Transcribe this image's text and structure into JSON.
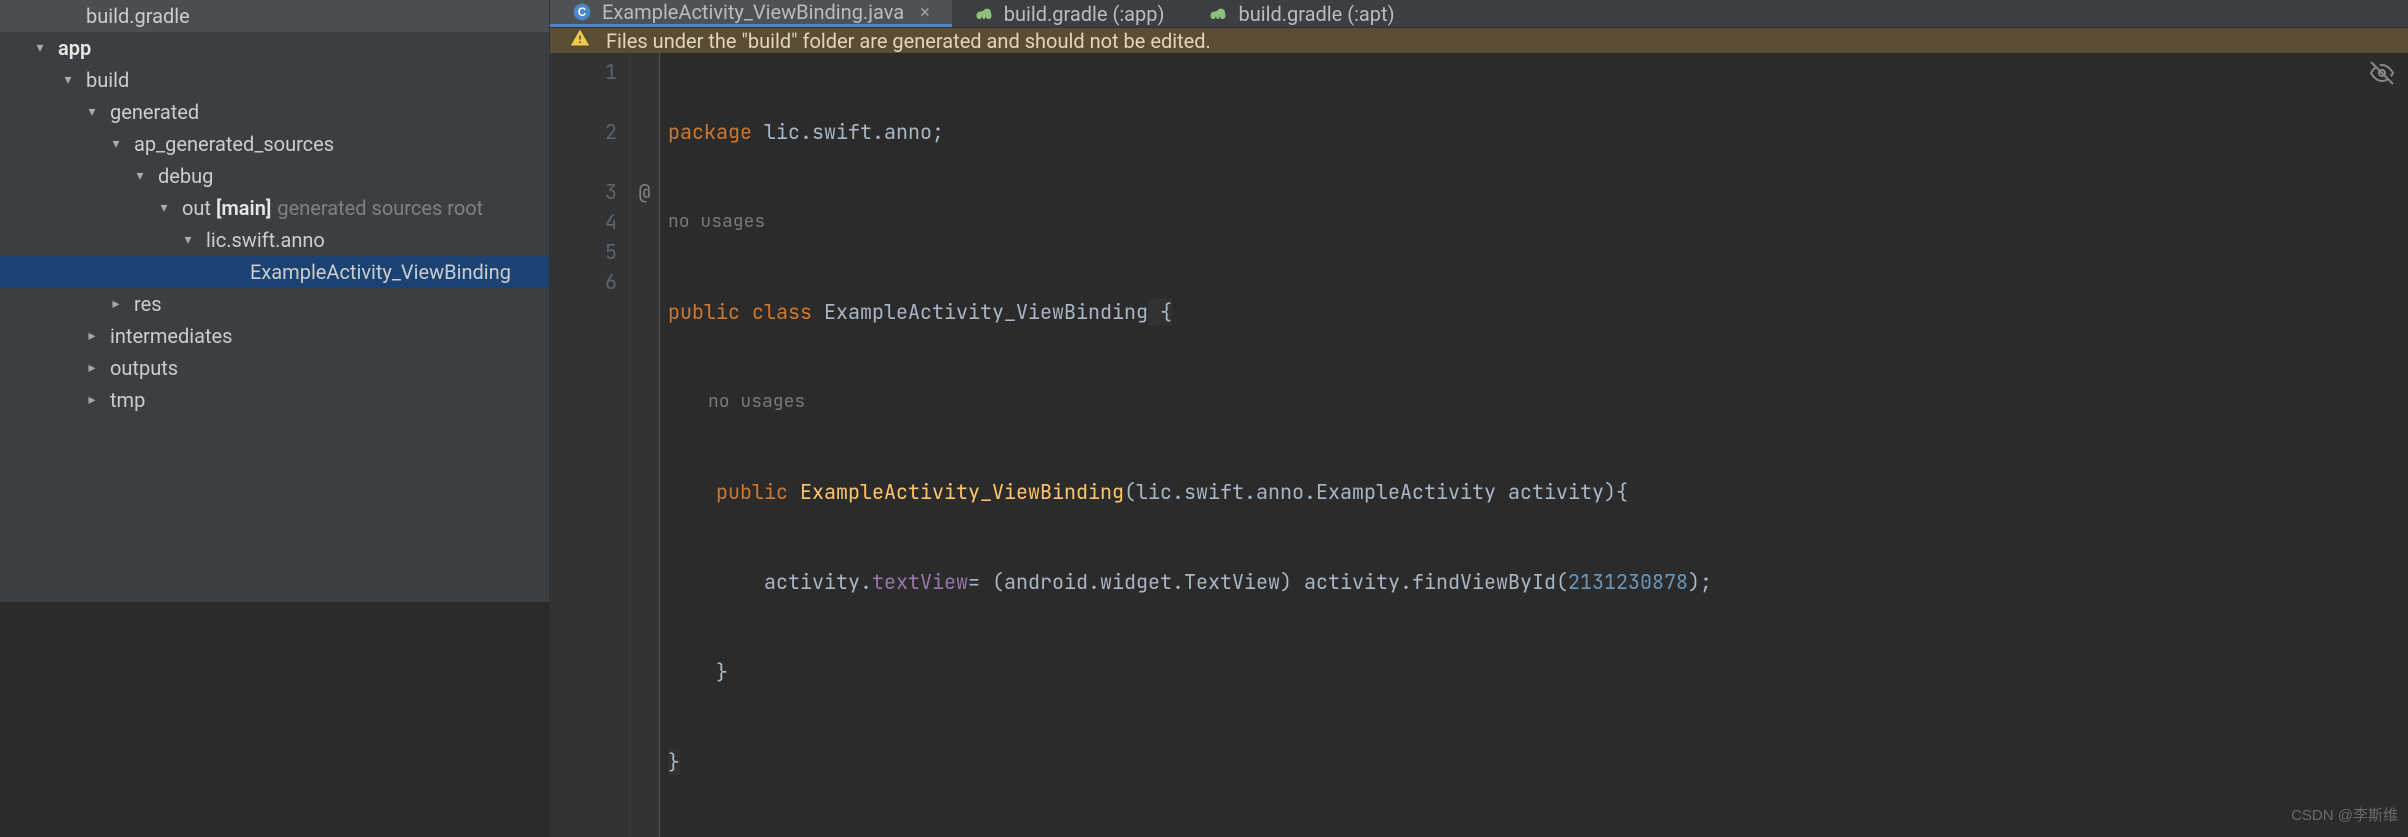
{
  "tree": [
    {
      "indent": 58,
      "chev": "none",
      "icon": "gradle",
      "label": "build.gradle"
    },
    {
      "indent": 30,
      "chev": "down",
      "icon": "module",
      "label": "app",
      "bold": true
    },
    {
      "indent": 58,
      "chev": "down",
      "icon": "folder",
      "label": "build"
    },
    {
      "indent": 82,
      "chev": "down",
      "icon": "folder",
      "label": "generated"
    },
    {
      "indent": 106,
      "chev": "down",
      "icon": "folder",
      "label": "ap_generated_sources"
    },
    {
      "indent": 130,
      "chev": "down",
      "icon": "folder",
      "label": "debug"
    },
    {
      "indent": 154,
      "chev": "down",
      "icon": "srcroot",
      "label": "out",
      "bold_extra": "[main]",
      "muted": "generated sources root"
    },
    {
      "indent": 178,
      "chev": "down",
      "icon": "package",
      "label": "lic.swift.anno"
    },
    {
      "indent": 222,
      "chev": "none",
      "icon": "class",
      "label": "ExampleActivity_ViewBinding",
      "selected": true
    },
    {
      "indent": 106,
      "chev": "right",
      "icon": "folder",
      "label": "res"
    },
    {
      "indent": 82,
      "chev": "right",
      "icon": "folder",
      "label": "intermediates"
    },
    {
      "indent": 82,
      "chev": "right",
      "icon": "folder",
      "label": "outputs"
    },
    {
      "indent": 82,
      "chev": "right",
      "icon": "folder",
      "label": "tmp"
    }
  ],
  "tabs": [
    {
      "icon": "class",
      "label": "ExampleActivity_ViewBinding.java",
      "active": true,
      "closeable": true
    },
    {
      "icon": "gradle",
      "label": "build.gradle (:app)",
      "active": false
    },
    {
      "icon": "gradle",
      "label": "build.gradle (:apt)",
      "active": false
    }
  ],
  "banner": "Files under the \"build\" folder are generated and should not be edited.",
  "gutter_at_line": 3,
  "gutter_at_symbol": "@",
  "hints": {
    "no_usages": "no usages"
  },
  "code": {
    "line1": {
      "kw": "package",
      "rest": " lic.swift.anno;"
    },
    "line2": {
      "kw1": "public",
      "kw2": "class",
      "name": "ExampleActivity_ViewBinding",
      "brace": " {"
    },
    "line3": {
      "kw": "public",
      "ctor": "ExampleActivity_ViewBinding",
      "params": "(lic.swift.anno.ExampleActivity activity){"
    },
    "line4": {
      "pre": "        activity.",
      "prop": "textView",
      "mid": "= (android.widget.TextView) activity.findViewById(",
      "num": "2131230878",
      "end": ");"
    },
    "line5": "    }",
    "line6": "}"
  },
  "line_numbers": [
    "1",
    "2",
    "3",
    "4",
    "5",
    "6"
  ],
  "watermark": "CSDN @李斯维"
}
